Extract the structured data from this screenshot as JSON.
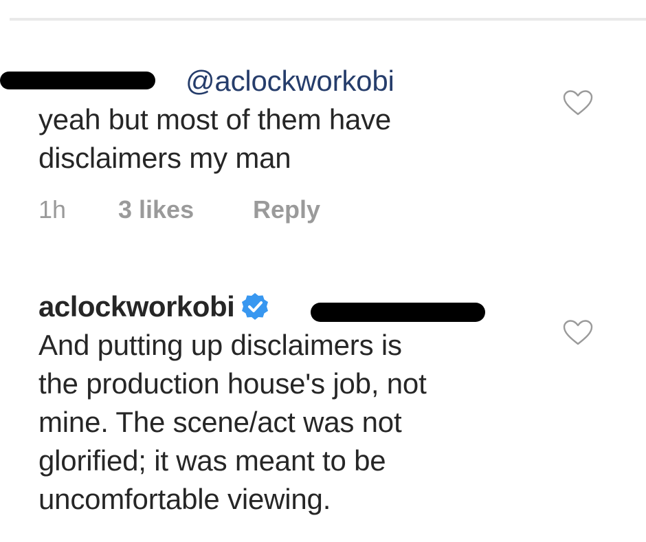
{
  "comments": [
    {
      "username": "",
      "mention": "@aclockworkobi",
      "text_lines": [
        "yeah but most of them have",
        "disclaimers my man"
      ],
      "time": "1h",
      "likes": "3 likes",
      "reply": "Reply",
      "like_icon": "heart-outline-icon"
    },
    {
      "username": "aclockworkobi",
      "verified": true,
      "mention": "",
      "text_lines": [
        "And putting up disclaimers is",
        "the production house's job, not",
        "mine. The scene/act was not",
        "glorified; it was meant to be",
        "uncomfortable viewing."
      ],
      "like_icon": "heart-outline-icon"
    }
  ],
  "colors": {
    "mention": "#263d6b",
    "meta": "#9a9a9a",
    "verified_badge": "#3897f0"
  }
}
